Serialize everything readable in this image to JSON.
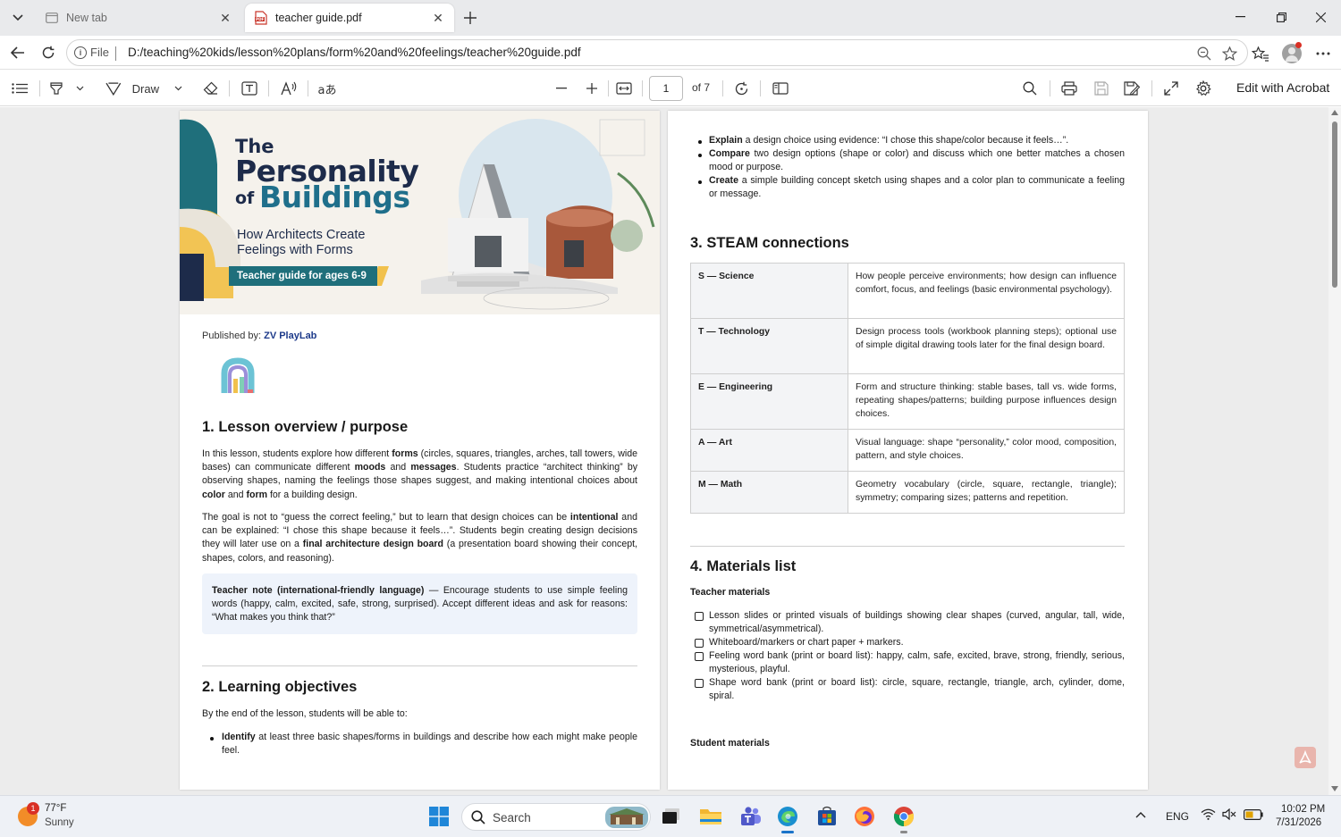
{
  "browser": {
    "tabs": [
      {
        "title": "New tab",
        "active": false,
        "icon": "newtab-icon"
      },
      {
        "title": "teacher guide.pdf",
        "active": true,
        "icon": "pdf-icon"
      }
    ],
    "omnibox": {
      "info_label": "File",
      "url": "D:/teaching%20kids/lesson%20plans/form%20and%20feelings/teacher%20guide.pdf"
    }
  },
  "pdf_toolbar": {
    "draw_label": "Draw",
    "translate_glyph": "aあ",
    "page_current": "1",
    "page_of": "of 7",
    "edit_label": "Edit with Acrobat"
  },
  "hero": {
    "the": "The",
    "personality": "Personality",
    "of": "of",
    "buildings": "Buildings",
    "subtitle": "How Architects Create Feelings with Forms",
    "banner": "Teacher guide for ages 6-9"
  },
  "left_page": {
    "published_prefix": "Published by:",
    "publisher": "ZV PlayLab",
    "s1_heading": "1. Lesson overview / purpose",
    "s1_p1": {
      "a": "In this lesson, students explore how different ",
      "b1": "forms",
      "c": " (circles, squares, triangles, arches, tall towers, wide bases) can communicate different ",
      "b2": "moods",
      "d": " and ",
      "b3": "messages",
      "e": ". Students practice “architect thinking” by observing shapes, naming the feelings those shapes suggest, and making intentional choices about ",
      "b4": "color",
      "f": " and ",
      "b5": "form",
      "g": " for a building design."
    },
    "s1_p2": {
      "a": "The goal is not to “guess the correct feeling,” but to learn that design choices can be ",
      "b1": "intentional",
      "c": " and can be explained: “I chose this shape because it feels…”. Students begin creating design decisions they will later use on a ",
      "b2": "final architecture design board",
      "d": " (a presentation board showing their concept, shapes, colors, and reasoning)."
    },
    "note": {
      "bold": "Teacher note (international-friendly language)",
      "text": " — Encourage students to use simple feeling words (happy, calm, excited, safe, strong, surprised). Accept different ideas and ask for reasons: “What makes you think that?”"
    },
    "s2_heading": "2. Learning objectives",
    "s2_intro": "By the end of the lesson, students will be able to:",
    "s2_bullet1": {
      "bold": "Identify",
      "text": " at least three basic shapes/forms in buildings and describe how each might make people feel."
    }
  },
  "right_page": {
    "bullets": [
      {
        "bold": "Explain",
        "text": " a design choice using evidence: “I chose this shape/color because it feels…”."
      },
      {
        "bold": "Compare",
        "text": " two design options (shape or color) and discuss which one better matches a chosen mood or purpose."
      },
      {
        "bold": "Create",
        "text": " a simple building concept sketch using shapes and a color plan to communicate a feeling or message."
      }
    ],
    "s3_heading": "3. STEAM connections",
    "steam": [
      {
        "key": "S — Science",
        "value": "How people perceive environments; how design can influence comfort, focus, and feelings (basic environmental psychology)."
      },
      {
        "key": "T — Technology",
        "value": "Design process tools (workbook planning steps); optional use of simple digital drawing tools later for the final design board."
      },
      {
        "key": "E — Engineering",
        "value": "Form and structure thinking: stable bases, tall vs. wide forms, repeating shapes/patterns; building purpose influences design choices."
      },
      {
        "key": "A — Art",
        "value": "Visual language: shape “personality,” color mood, composition, pattern, and style choices."
      },
      {
        "key": "M — Math",
        "value": "Geometry vocabulary (circle, square, rectangle, triangle); symmetry; comparing sizes; patterns and repetition."
      }
    ],
    "s4_heading": "4. Materials list",
    "teacher_materials_label": "Teacher materials",
    "teacher_materials": [
      "Lesson slides or printed visuals of buildings showing clear shapes (curved, angular, tall, wide, symmetrical/asymmetrical).",
      "Whiteboard/markers or chart paper + markers.",
      "Feeling word bank (print or board list): happy, calm, safe, excited, brave, strong, friendly, serious, mysterious, playful.",
      "Shape word bank (print or board list): circle, square, rectangle, triangle, arch, cylinder, dome, spiral."
    ],
    "student_materials_label": "Student materials"
  },
  "taskbar": {
    "weather_temp": "77°F",
    "weather_cond": "Sunny",
    "weather_badge": "1",
    "search_label": "Search",
    "lang": "ENG",
    "time": "10:02 PM",
    "date": "7/31/2026"
  }
}
